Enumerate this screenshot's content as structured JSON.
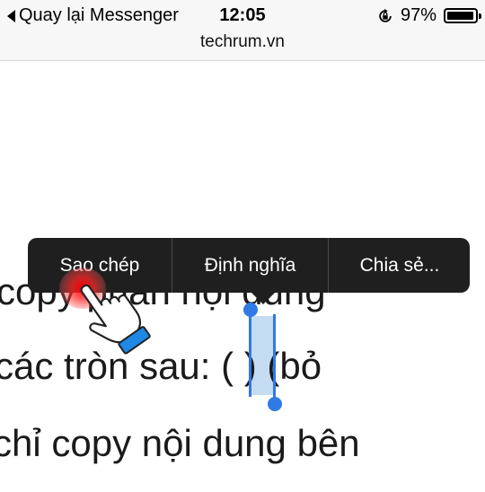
{
  "status_bar": {
    "back_label": "Quay lại Messenger",
    "time": "12:05",
    "battery_percent": "97%",
    "battery_level": 0.97,
    "icons": [
      "back-arrow-icon",
      "rotation-lock-icon",
      "battery-icon"
    ]
  },
  "url_bar": {
    "domain": "techrum.vn"
  },
  "article": {
    "line1": "copy phần nội dung",
    "line2": "các tròn sau: ( ) (bỏ",
    "line3": "chỉ copy nội dung bên"
  },
  "context_menu": {
    "items": [
      "Sao chép",
      "Định nghĩa",
      "Chia sẻ..."
    ]
  },
  "colors": {
    "selection": "#c5dbf2",
    "selection_handle": "#2f7ae5",
    "menu_background": "#1f1f1f",
    "tap_highlight": "#ff0000",
    "hand_cuff": "#1e88e5"
  }
}
